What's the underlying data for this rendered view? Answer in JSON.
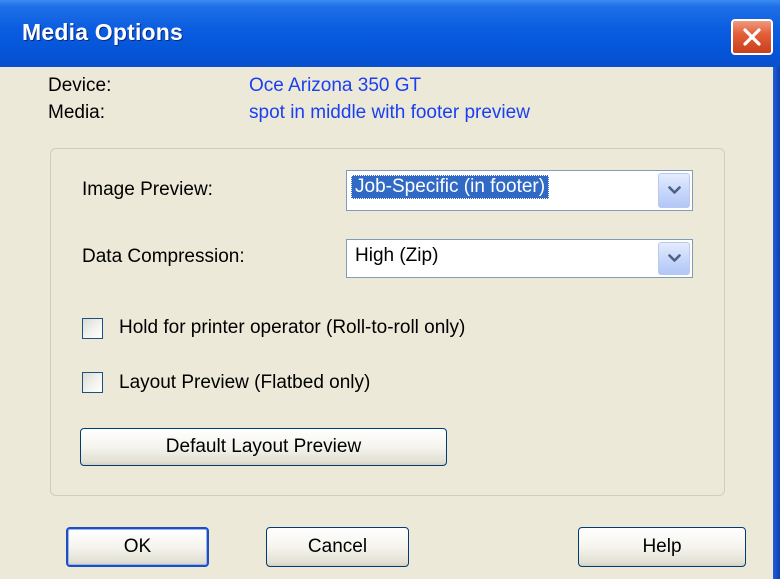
{
  "window": {
    "title": "Media Options",
    "close_icon": "close-x-icon"
  },
  "info": {
    "device_label": "Device:",
    "device_value": "Oce Arizona 350 GT",
    "media_label": "Media:",
    "media_value": "spot in middle with footer preview"
  },
  "options": {
    "image_preview_label": "Image Preview:",
    "image_preview_value": "Job-Specific (in footer)",
    "data_compression_label": "Data Compression:",
    "data_compression_value": "High (Zip)",
    "hold_label": "Hold for printer operator  (Roll-to-roll only)",
    "hold_checked": false,
    "layout_preview_label": "Layout Preview  (Flatbed only)",
    "layout_preview_checked": false,
    "default_layout_button": "Default Layout Preview"
  },
  "buttons": {
    "ok": "OK",
    "cancel": "Cancel",
    "help": "Help"
  },
  "colors": {
    "titlebar": "#0554d8",
    "dialog_bg": "#ece9d8",
    "info_value": "#1a3ff0",
    "selection": "#316ac5",
    "close_button": "#e35f38"
  }
}
